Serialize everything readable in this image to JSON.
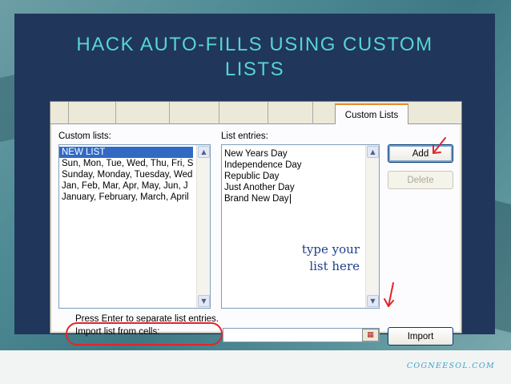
{
  "slide": {
    "title_line1": "HACK AUTO-FILLS USING CUSTOM",
    "title_line2": "LISTS",
    "footer": "COGNEESOL.COM"
  },
  "dialog": {
    "tab_label": "Custom Lists",
    "custom_lists_label": "Custom lists:",
    "list_entries_label": "List entries:",
    "custom_lists": [
      "NEW LIST",
      "Sun, Mon, Tue, Wed, Thu, Fri, S",
      "Sunday, Monday, Tuesday, Wed",
      "Jan, Feb, Mar, Apr, May, Jun, J",
      "January, February, March, April"
    ],
    "list_entries": [
      "New Years Day",
      "Independence Day",
      "Republic Day",
      "Just Another Day",
      "Brand New Day"
    ],
    "add_button": "Add",
    "delete_button": "Delete",
    "hint": "Press Enter to separate list entries.",
    "import_label": "Import list from cells:",
    "import_value": "",
    "import_button": "Import"
  },
  "annotations": {
    "note_line1": "type your",
    "note_line2": "list here",
    "accent_color": "#e0262a"
  }
}
